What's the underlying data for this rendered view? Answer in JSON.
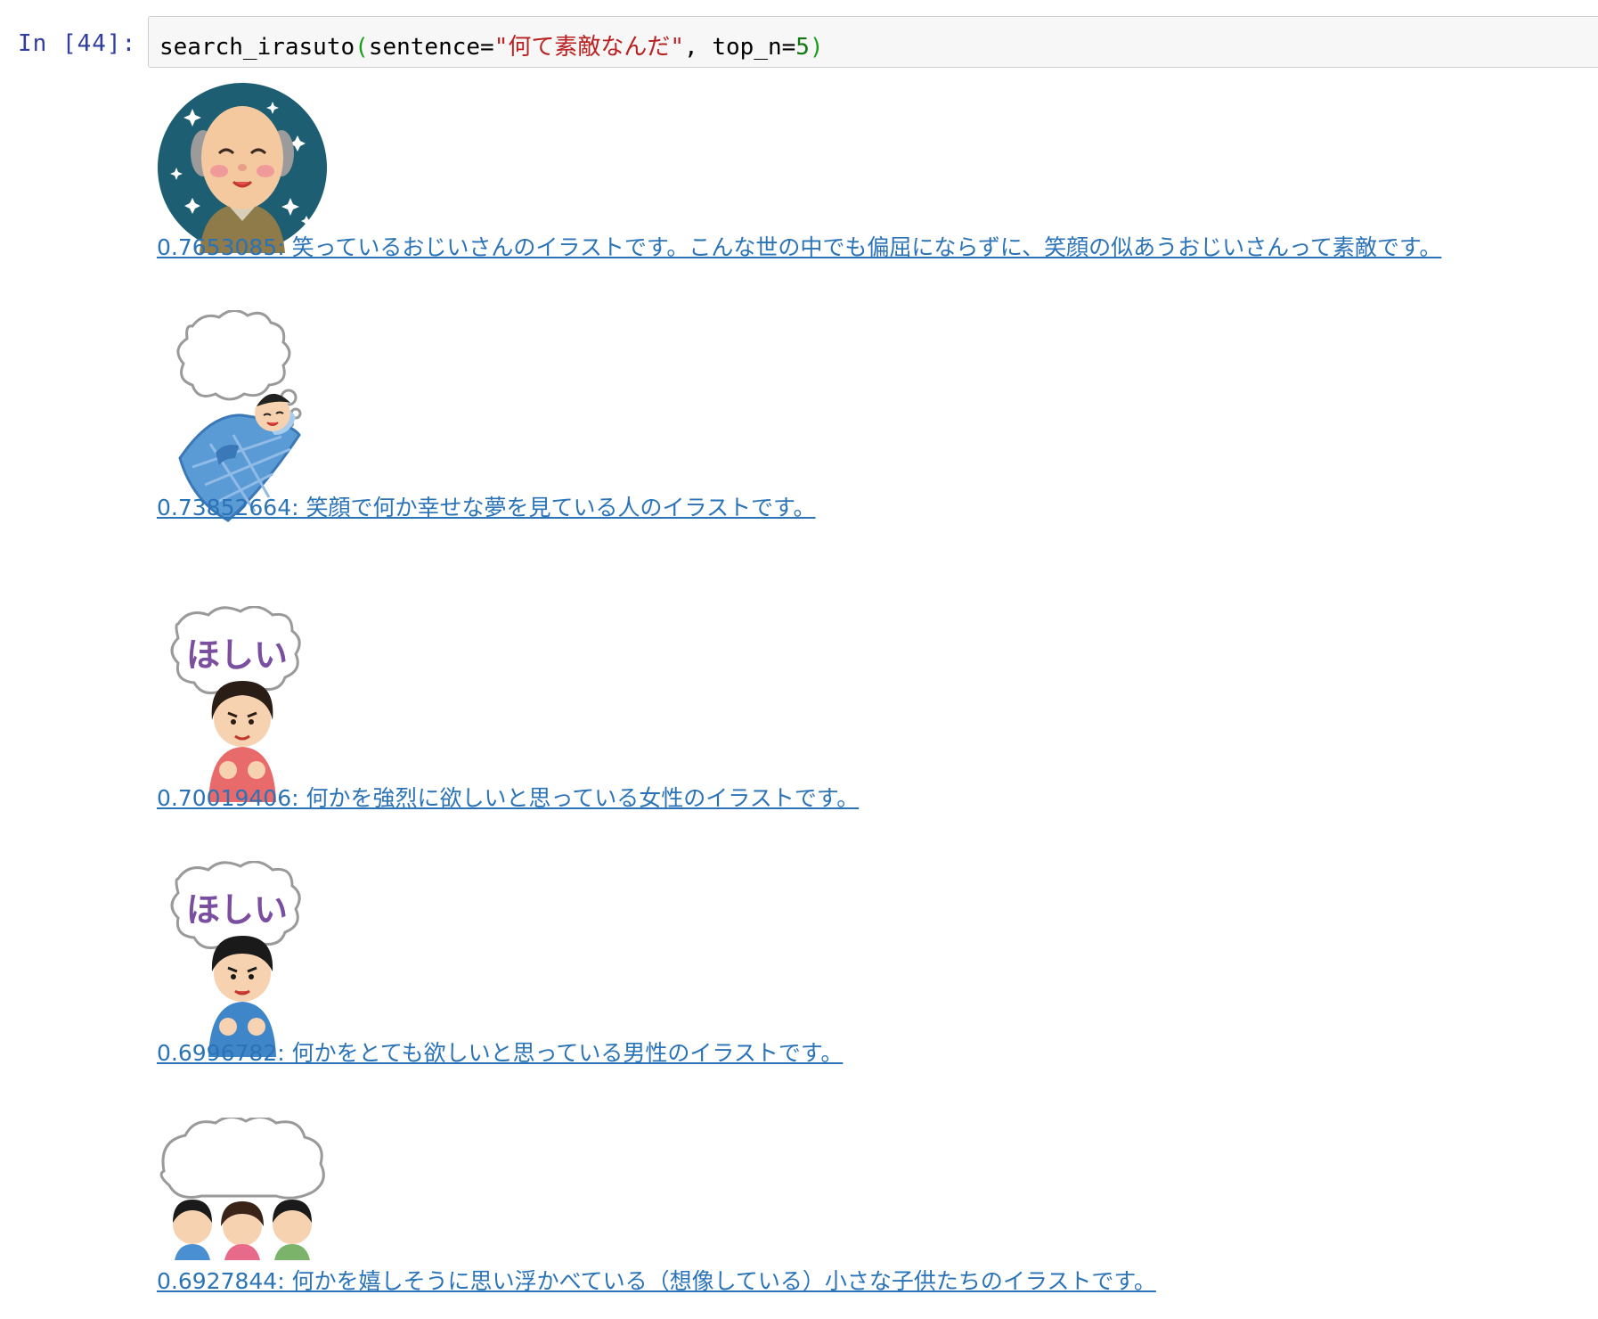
{
  "cell": {
    "prompt": "In [44]:",
    "code": {
      "func": "search_irasuto",
      "open_paren": "(",
      "arg1_name": "sentence=",
      "arg1_value": "\"何て素敵なんだ\"",
      "sep": ", ",
      "arg2_name": "top_n=",
      "arg2_value": "5",
      "close_paren": ")"
    }
  },
  "results": [
    {
      "caption": "0.7653085: 笑っているおじいさんのイラストです。こんな世の中でも偏屈にならずに、笑顔の似あうおじいさんって素敵です。",
      "image_icon": "smiling-grandfather-illustration"
    },
    {
      "caption": "0.73852664: 笑顔で何か幸せな夢を見ている人のイラストです。",
      "image_icon": "dreaming-person-illustration"
    },
    {
      "caption": "0.70019406: 何かを強烈に欲しいと思っている女性のイラストです。",
      "image_icon": "wanting-woman-illustration",
      "bubble_text": "ほしい"
    },
    {
      "caption": "0.6996782: 何かをとても欲しいと思っている男性のイラストです。",
      "image_icon": "wanting-man-illustration",
      "bubble_text": "ほしい"
    },
    {
      "caption": "0.6927844: 何かを嬉しそうに思い浮かべている（想像している）小さな子供たちのイラストです。",
      "image_icon": "imagining-children-illustration"
    }
  ],
  "colors": {
    "prompt": "#303f9f",
    "link": "#2b73b7",
    "string": "#ba2121",
    "number": "#117711",
    "paren": "#1a9e1a",
    "bubble_text": "#7a4fa0"
  }
}
